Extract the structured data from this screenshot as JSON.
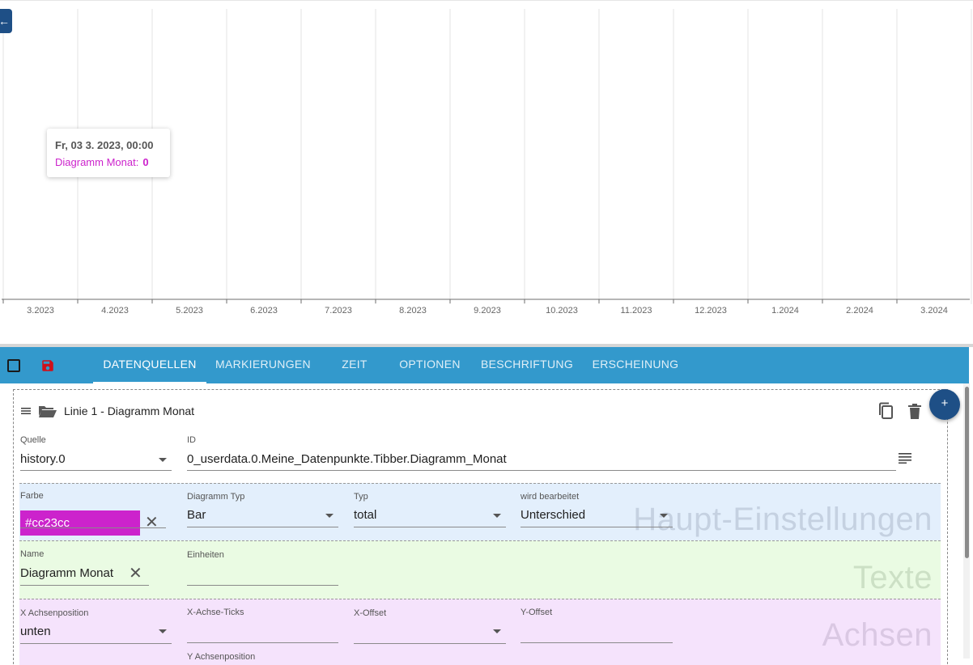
{
  "chart": {
    "x_ticks": [
      "3.2023",
      "4.2023",
      "5.2023",
      "6.2023",
      "7.2023",
      "8.2023",
      "9.2023",
      "10.2023",
      "11.2023",
      "12.2023",
      "1.2024",
      "2.2024",
      "3.2024"
    ],
    "tooltip": {
      "date": "Fr, 03 3. 2023, 00:00",
      "series": "Diagramm Monat:",
      "value": "0"
    },
    "series_color": "#cc23cc"
  },
  "toolbar": {
    "tabs": [
      "DATENQUELLEN",
      "MARKIERUNGEN",
      "ZEIT",
      "OPTIONEN",
      "BESCHRIFTUNG",
      "ERSCHEINUNG"
    ],
    "active_tab": "DATENQUELLEN"
  },
  "line": {
    "title": "Linie 1 - Diagramm Monat",
    "source": {
      "label": "Quelle",
      "value": "history.0"
    },
    "id": {
      "label": "ID",
      "value": "0_userdata.0.Meine_Datenpunkte.Tibber.Diagramm_Monat"
    },
    "main": {
      "section": "Haupt-Einstellungen",
      "color": {
        "label": "Farbe",
        "value": "#cc23cc"
      },
      "chart_type": {
        "label": "Diagramm Typ",
        "value": "Bar"
      },
      "type": {
        "label": "Typ",
        "value": "total"
      },
      "processing": {
        "label": "wird bearbeitet",
        "value": "Unterschied"
      }
    },
    "texts": {
      "section": "Texte",
      "name": {
        "label": "Name",
        "value": "Diagramm Monat"
      },
      "units": {
        "label": "Einheiten",
        "value": ""
      }
    },
    "axes": {
      "section": "Achsen",
      "x_position": {
        "label": "X Achsenposition",
        "value": "unten"
      },
      "x_ticks": {
        "label": "X-Achse-Ticks",
        "value": ""
      },
      "x_offset": {
        "label": "X-Offset",
        "value": ""
      },
      "y_offset": {
        "label": "Y-Offset",
        "value": ""
      },
      "y_position": {
        "label": "Y Achsenposition"
      }
    }
  }
}
